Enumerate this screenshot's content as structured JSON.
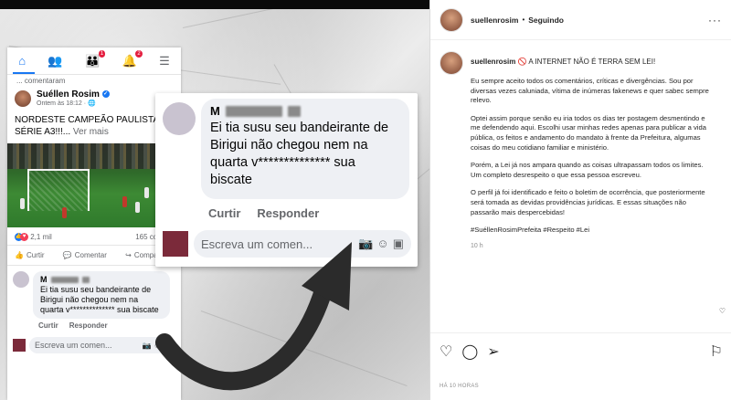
{
  "facebook_post": {
    "prev_text": "... comentaram",
    "author": "Suéllen Rosim",
    "timestamp": "Ontem às 18:12 · ",
    "text": "NORDESTE CAMPEÃO PAULISTA SÉRIE A3!!!...",
    "see_more": " Ver mais",
    "reaction_count": "2,1 mil",
    "comment_count": "165 coment",
    "like_label": "Curtir",
    "comment_label": "Comentar",
    "share_label": "Compartilha"
  },
  "comment": {
    "initial": "M",
    "text": "Ei tia susu seu bandeirante de Birigui não chegou nem na quarta v************** sua biscate",
    "like_label": "Curtir",
    "reply_label": "Responder",
    "write_placeholder": "Escreva um comen..."
  },
  "zoom": {
    "initial": "M",
    "text": "Ei tia susu seu bandeirante de Birigui não chegou nem na quarta v************** sua biscate",
    "like_label": "Curtir",
    "reply_label": "Responder",
    "write_placeholder": "Escreva um comen..."
  },
  "instagram": {
    "username": "suellenrosim",
    "dot": "•",
    "follow_status": "Seguindo",
    "caption_user": "suellenrosim",
    "caption_text": " 🚫 A INTERNET NÃO É TERRA SEM LEI!",
    "paragraphs": [
      "Eu sempre aceito todos os comentários, críticas e divergências. Sou por diversas vezes caluniada, vítima de inúmeras fakenews e quer sabec sempre relevo.",
      "Optei assim porque senão eu iria todos os dias ter postagem desmentindo e me defendendo aqui. Escolhi usar minhas redes apenas para publicar a vida pública, os feitos e andamento do mandato à frente da Prefeitura, algumas coisas do meu cotidiano familiar e ministério.",
      "Porém, a Lei já nos ampara quando as coisas ultrapassam todos os limites. Um completo desrespeito o que essa pessoa escreveu.",
      "O perfil já foi identificado e feito o boletim de ocorrência, que posteriormente será tomada as devidas providências jurídicas. E essas situações não passarão mais despercebidas!",
      "#SuéllenRosimPrefeita #Respeito #Lei"
    ],
    "time": "10 h",
    "ago": "HÁ 10 HORAS"
  },
  "icons": {
    "home": "home-icon",
    "friends": "friends-icon",
    "groups": "groups-icon",
    "notifications": "bell-icon",
    "menu": "menu-icon",
    "like": "thumbs-up-icon",
    "comment": "comment-icon",
    "share": "share-icon",
    "camera": "camera-icon",
    "emoji": "emoji-icon",
    "gif": "gif-icon",
    "heart": "heart-icon",
    "send": "send-icon",
    "save": "bookmark-icon"
  },
  "colors": {
    "facebook_blue": "#1877f2",
    "notification_red": "#e41e3f",
    "comment_bubble": "#eef0f4",
    "hashtag": "#262626"
  }
}
